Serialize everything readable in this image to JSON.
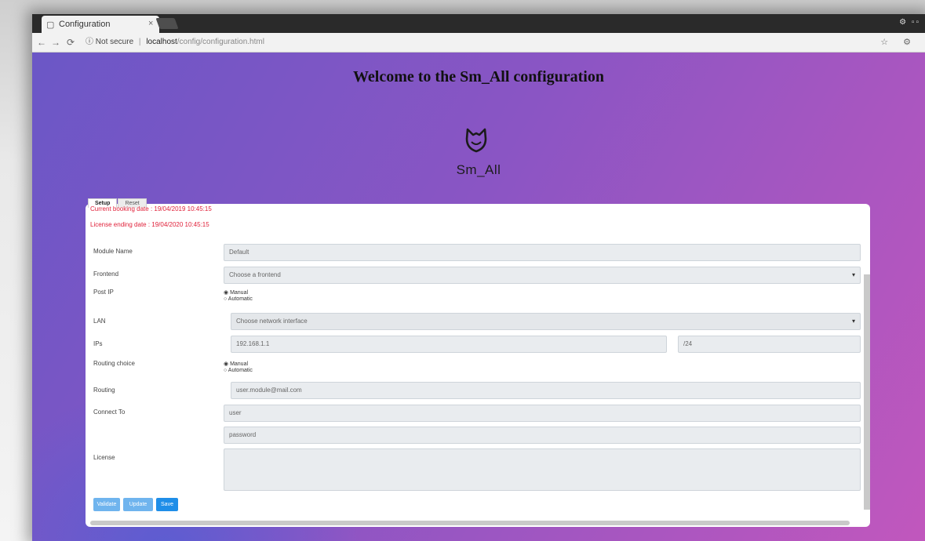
{
  "browser": {
    "tab_title": "Configuration",
    "tab_close": "×",
    "url_info": "Not secure",
    "url_host": "localhost",
    "url_path": "/config/configuration.html",
    "back": "←",
    "forward": "→",
    "reload": "⟳",
    "info_icon": "ⓘ",
    "tray": "⚙ ▫▫",
    "right_icons": "☆ ⚙"
  },
  "page": {
    "welcome": "Welcome to the Sm_All configuration",
    "brand": "Sm_All"
  },
  "card": {
    "tabs": [
      "Setup",
      "Reset"
    ],
    "warnings": [
      "Current booking date : 19/04/2019 10:45:15",
      "License ending date : 19/04/2020 10:45:15"
    ],
    "rows": {
      "module_name": {
        "label": "Module Name",
        "value": "Default"
      },
      "frontend": {
        "label": "Frontend",
        "value": "Choose a frontend"
      },
      "post_ip": {
        "label": "Post IP",
        "options": [
          "Manual",
          "Automatic"
        ]
      },
      "lan": {
        "label": "LAN",
        "value": "Choose network interface"
      },
      "ip": {
        "label": "IPs",
        "value": "192.168.1.1",
        "mask": "/24"
      },
      "routing_choice": {
        "label": "Routing choice",
        "options": [
          "Manual",
          "Automatic"
        ]
      },
      "routing": {
        "label": "Routing",
        "value": "user.module@mail.com"
      },
      "connect": {
        "label": "Connect To",
        "user": "user",
        "password": "password"
      },
      "license": {
        "label": "License",
        "value": ""
      }
    },
    "buttons": [
      "Validate",
      "Update",
      "Save"
    ]
  },
  "colors": {
    "gradient_start": "#6b57c6",
    "gradient_end": "#c157bd",
    "warning": "#e0213a",
    "button_primary": "#1f8ee8",
    "button_light": "#6fb4ee"
  }
}
